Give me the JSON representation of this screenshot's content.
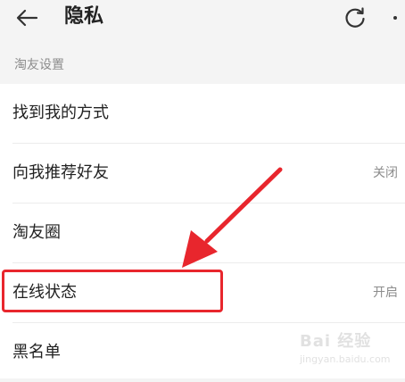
{
  "header": {
    "title": "隐私",
    "back_icon": "arrow-left-icon",
    "refresh_icon": "refresh-icon",
    "more_icon": "more-icon"
  },
  "section": {
    "title": "淘友设置"
  },
  "rows": [
    {
      "label": "找到我的方式",
      "value": ""
    },
    {
      "label": "向我推荐好友",
      "value": "关闭"
    },
    {
      "label": "淘友圈",
      "value": ""
    },
    {
      "label": "在线状态",
      "value": "开启"
    },
    {
      "label": "黑名单",
      "value": ""
    }
  ],
  "annotation": {
    "highlight_color": "#e8262d"
  },
  "watermark": {
    "brand": "Bai 经验",
    "url": "jingyan.baidu.com"
  }
}
